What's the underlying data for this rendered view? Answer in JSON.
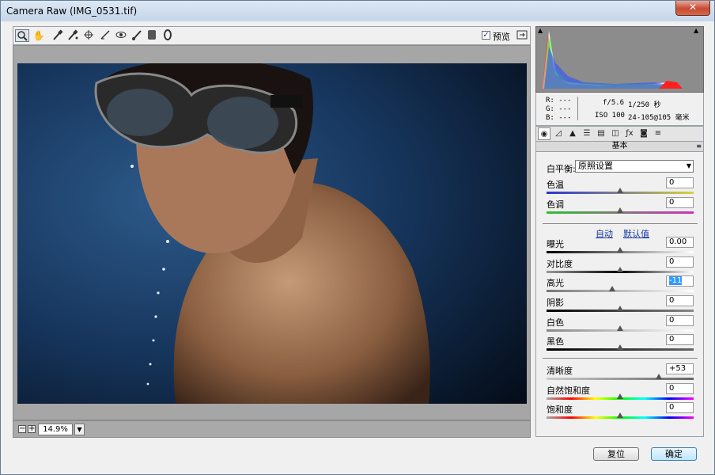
{
  "window": {
    "title": "Camera Raw (IMG_0531.tif)",
    "close_glyph": "✕"
  },
  "toolbar": {
    "tools": [
      "zoom-icon",
      "hand-icon",
      "white-balance-icon",
      "color-sampler-icon",
      "targeted-adjustment-icon",
      "crop-icon",
      "straighten-icon",
      "red-eye-icon",
      "adjustment-brush-icon",
      "graduated-filter-icon",
      "radial-filter-icon"
    ],
    "preview_label": "预览",
    "preview_checked": true
  },
  "zoom": {
    "minus": "−",
    "plus": "+",
    "value": "14.9%"
  },
  "info": {
    "r": "R: ---",
    "g": "G: ---",
    "b": "B: ---",
    "aperture": "f/5.6",
    "shutter": "1/250 秒",
    "iso": "ISO 100",
    "lens": "24-105@105 毫米"
  },
  "panel": {
    "title": "基本",
    "white_balance": {
      "label": "白平衡:",
      "value": "原照设置"
    },
    "auto": "自动",
    "default": "默认值",
    "sliders": [
      {
        "label": "色温",
        "value": "0",
        "level": 0.5
      },
      {
        "label": "色调",
        "value": "0",
        "level": 0.5
      },
      {
        "label": "曝光",
        "value": "0.00",
        "level": 0.5
      },
      {
        "label": "对比度",
        "value": "0",
        "level": 0.5
      },
      {
        "label": "高光",
        "value": "-11",
        "level": 0.445
      },
      {
        "label": "阴影",
        "value": "0",
        "level": 0.5
      },
      {
        "label": "白色",
        "value": "0",
        "level": 0.5
      },
      {
        "label": "黑色",
        "value": "0",
        "level": 0.5
      },
      {
        "label": "清晰度",
        "value": "+53",
        "level": 0.765
      },
      {
        "label": "自然饱和度",
        "value": "0",
        "level": 0.5
      },
      {
        "label": "饱和度",
        "value": "0",
        "level": 0.5
      }
    ]
  },
  "buttons": {
    "reset": "复位",
    "ok": "确定"
  }
}
